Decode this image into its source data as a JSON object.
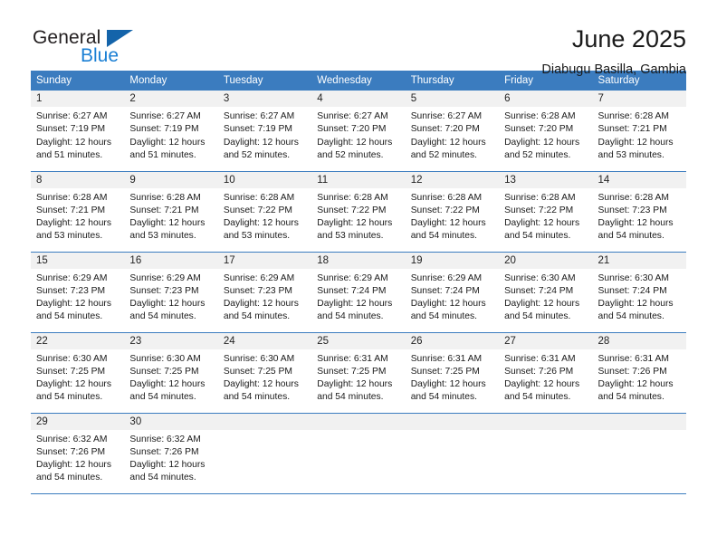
{
  "logo": {
    "word_top": "General",
    "word_bottom": "Blue",
    "triangle_color": "#1464aa",
    "blue_text_color": "#1a7fd4"
  },
  "header": {
    "title": "June 2025",
    "location": "Diabugu Basilla, Gambia"
  },
  "theme": {
    "header_blue": "#3b7cbf",
    "daynum_band": "#f1f1f1",
    "text": "#1a1a1a"
  },
  "calendar": {
    "weekday_headers": [
      "Sunday",
      "Monday",
      "Tuesday",
      "Wednesday",
      "Thursday",
      "Friday",
      "Saturday"
    ],
    "weeks": [
      [
        {
          "day": "1",
          "sunrise": "Sunrise: 6:27 AM",
          "sunset": "Sunset: 7:19 PM",
          "daylight_line1": "Daylight: 12 hours",
          "daylight_line2": "and 51 minutes."
        },
        {
          "day": "2",
          "sunrise": "Sunrise: 6:27 AM",
          "sunset": "Sunset: 7:19 PM",
          "daylight_line1": "Daylight: 12 hours",
          "daylight_line2": "and 51 minutes."
        },
        {
          "day": "3",
          "sunrise": "Sunrise: 6:27 AM",
          "sunset": "Sunset: 7:19 PM",
          "daylight_line1": "Daylight: 12 hours",
          "daylight_line2": "and 52 minutes."
        },
        {
          "day": "4",
          "sunrise": "Sunrise: 6:27 AM",
          "sunset": "Sunset: 7:20 PM",
          "daylight_line1": "Daylight: 12 hours",
          "daylight_line2": "and 52 minutes."
        },
        {
          "day": "5",
          "sunrise": "Sunrise: 6:27 AM",
          "sunset": "Sunset: 7:20 PM",
          "daylight_line1": "Daylight: 12 hours",
          "daylight_line2": "and 52 minutes."
        },
        {
          "day": "6",
          "sunrise": "Sunrise: 6:28 AM",
          "sunset": "Sunset: 7:20 PM",
          "daylight_line1": "Daylight: 12 hours",
          "daylight_line2": "and 52 minutes."
        },
        {
          "day": "7",
          "sunrise": "Sunrise: 6:28 AM",
          "sunset": "Sunset: 7:21 PM",
          "daylight_line1": "Daylight: 12 hours",
          "daylight_line2": "and 53 minutes."
        }
      ],
      [
        {
          "day": "8",
          "sunrise": "Sunrise: 6:28 AM",
          "sunset": "Sunset: 7:21 PM",
          "daylight_line1": "Daylight: 12 hours",
          "daylight_line2": "and 53 minutes."
        },
        {
          "day": "9",
          "sunrise": "Sunrise: 6:28 AM",
          "sunset": "Sunset: 7:21 PM",
          "daylight_line1": "Daylight: 12 hours",
          "daylight_line2": "and 53 minutes."
        },
        {
          "day": "10",
          "sunrise": "Sunrise: 6:28 AM",
          "sunset": "Sunset: 7:22 PM",
          "daylight_line1": "Daylight: 12 hours",
          "daylight_line2": "and 53 minutes."
        },
        {
          "day": "11",
          "sunrise": "Sunrise: 6:28 AM",
          "sunset": "Sunset: 7:22 PM",
          "daylight_line1": "Daylight: 12 hours",
          "daylight_line2": "and 53 minutes."
        },
        {
          "day": "12",
          "sunrise": "Sunrise: 6:28 AM",
          "sunset": "Sunset: 7:22 PM",
          "daylight_line1": "Daylight: 12 hours",
          "daylight_line2": "and 54 minutes."
        },
        {
          "day": "13",
          "sunrise": "Sunrise: 6:28 AM",
          "sunset": "Sunset: 7:22 PM",
          "daylight_line1": "Daylight: 12 hours",
          "daylight_line2": "and 54 minutes."
        },
        {
          "day": "14",
          "sunrise": "Sunrise: 6:28 AM",
          "sunset": "Sunset: 7:23 PM",
          "daylight_line1": "Daylight: 12 hours",
          "daylight_line2": "and 54 minutes."
        }
      ],
      [
        {
          "day": "15",
          "sunrise": "Sunrise: 6:29 AM",
          "sunset": "Sunset: 7:23 PM",
          "daylight_line1": "Daylight: 12 hours",
          "daylight_line2": "and 54 minutes."
        },
        {
          "day": "16",
          "sunrise": "Sunrise: 6:29 AM",
          "sunset": "Sunset: 7:23 PM",
          "daylight_line1": "Daylight: 12 hours",
          "daylight_line2": "and 54 minutes."
        },
        {
          "day": "17",
          "sunrise": "Sunrise: 6:29 AM",
          "sunset": "Sunset: 7:23 PM",
          "daylight_line1": "Daylight: 12 hours",
          "daylight_line2": "and 54 minutes."
        },
        {
          "day": "18",
          "sunrise": "Sunrise: 6:29 AM",
          "sunset": "Sunset: 7:24 PM",
          "daylight_line1": "Daylight: 12 hours",
          "daylight_line2": "and 54 minutes."
        },
        {
          "day": "19",
          "sunrise": "Sunrise: 6:29 AM",
          "sunset": "Sunset: 7:24 PM",
          "daylight_line1": "Daylight: 12 hours",
          "daylight_line2": "and 54 minutes."
        },
        {
          "day": "20",
          "sunrise": "Sunrise: 6:30 AM",
          "sunset": "Sunset: 7:24 PM",
          "daylight_line1": "Daylight: 12 hours",
          "daylight_line2": "and 54 minutes."
        },
        {
          "day": "21",
          "sunrise": "Sunrise: 6:30 AM",
          "sunset": "Sunset: 7:24 PM",
          "daylight_line1": "Daylight: 12 hours",
          "daylight_line2": "and 54 minutes."
        }
      ],
      [
        {
          "day": "22",
          "sunrise": "Sunrise: 6:30 AM",
          "sunset": "Sunset: 7:25 PM",
          "daylight_line1": "Daylight: 12 hours",
          "daylight_line2": "and 54 minutes."
        },
        {
          "day": "23",
          "sunrise": "Sunrise: 6:30 AM",
          "sunset": "Sunset: 7:25 PM",
          "daylight_line1": "Daylight: 12 hours",
          "daylight_line2": "and 54 minutes."
        },
        {
          "day": "24",
          "sunrise": "Sunrise: 6:30 AM",
          "sunset": "Sunset: 7:25 PM",
          "daylight_line1": "Daylight: 12 hours",
          "daylight_line2": "and 54 minutes."
        },
        {
          "day": "25",
          "sunrise": "Sunrise: 6:31 AM",
          "sunset": "Sunset: 7:25 PM",
          "daylight_line1": "Daylight: 12 hours",
          "daylight_line2": "and 54 minutes."
        },
        {
          "day": "26",
          "sunrise": "Sunrise: 6:31 AM",
          "sunset": "Sunset: 7:25 PM",
          "daylight_line1": "Daylight: 12 hours",
          "daylight_line2": "and 54 minutes."
        },
        {
          "day": "27",
          "sunrise": "Sunrise: 6:31 AM",
          "sunset": "Sunset: 7:26 PM",
          "daylight_line1": "Daylight: 12 hours",
          "daylight_line2": "and 54 minutes."
        },
        {
          "day": "28",
          "sunrise": "Sunrise: 6:31 AM",
          "sunset": "Sunset: 7:26 PM",
          "daylight_line1": "Daylight: 12 hours",
          "daylight_line2": "and 54 minutes."
        }
      ],
      [
        {
          "day": "29",
          "sunrise": "Sunrise: 6:32 AM",
          "sunset": "Sunset: 7:26 PM",
          "daylight_line1": "Daylight: 12 hours",
          "daylight_line2": "and 54 minutes."
        },
        {
          "day": "30",
          "sunrise": "Sunrise: 6:32 AM",
          "sunset": "Sunset: 7:26 PM",
          "daylight_line1": "Daylight: 12 hours",
          "daylight_line2": "and 54 minutes."
        },
        {
          "day": "",
          "sunrise": "",
          "sunset": "",
          "daylight_line1": "",
          "daylight_line2": ""
        },
        {
          "day": "",
          "sunrise": "",
          "sunset": "",
          "daylight_line1": "",
          "daylight_line2": ""
        },
        {
          "day": "",
          "sunrise": "",
          "sunset": "",
          "daylight_line1": "",
          "daylight_line2": ""
        },
        {
          "day": "",
          "sunrise": "",
          "sunset": "",
          "daylight_line1": "",
          "daylight_line2": ""
        },
        {
          "day": "",
          "sunrise": "",
          "sunset": "",
          "daylight_line1": "",
          "daylight_line2": ""
        }
      ]
    ]
  }
}
